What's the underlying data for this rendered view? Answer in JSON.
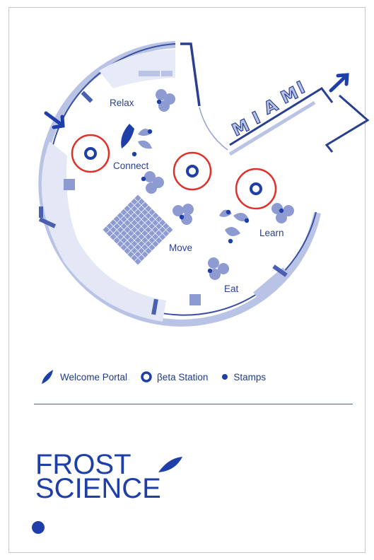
{
  "map": {
    "city_label": [
      "M",
      "I",
      "A",
      "M",
      "I"
    ],
    "zones": [
      {
        "label": "Relax"
      },
      {
        "label": "Connect"
      },
      {
        "label": "Move"
      },
      {
        "label": "Learn"
      },
      {
        "label": "Eat"
      }
    ],
    "beta_station_count": 3
  },
  "legend": {
    "welcome_portal": "Welcome Portal",
    "beta_station": "βeta Station",
    "stamps": "Stamps"
  },
  "logo": {
    "line1": "FROST",
    "line2": "SCIENCE"
  },
  "colors": {
    "navy": "#1f3fa8",
    "dark_blue": "#2a3f8f",
    "light_blue": "#b9c3e6",
    "pale_blue": "#d9dff3",
    "station_ring": "#e0302a"
  }
}
